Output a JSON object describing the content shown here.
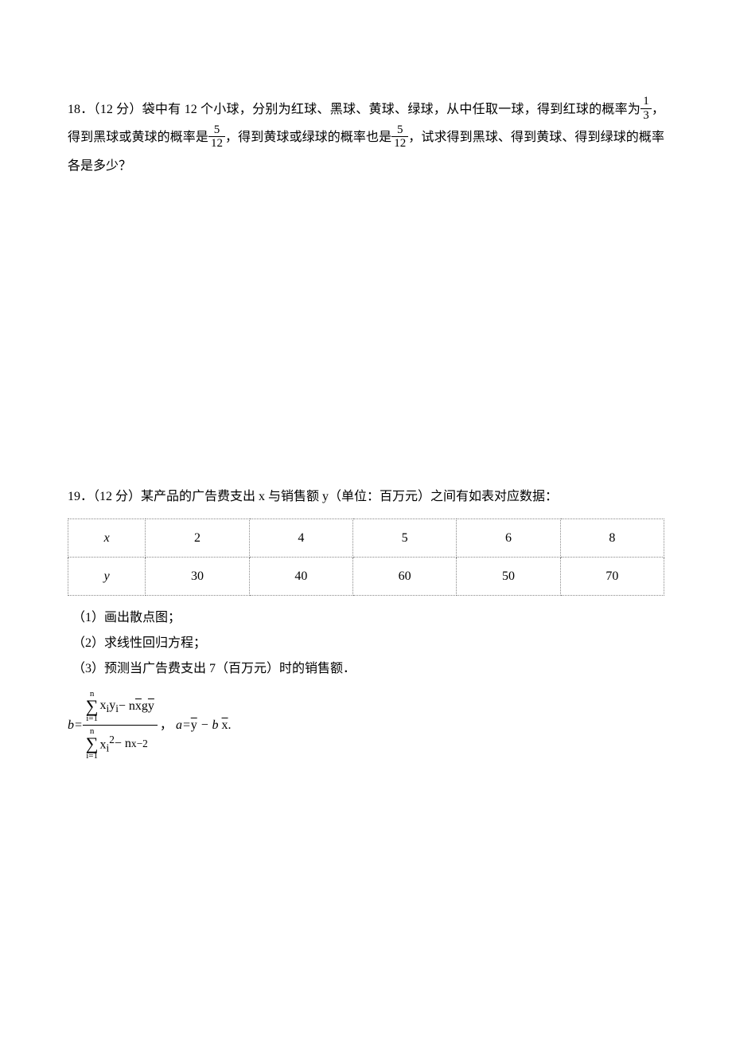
{
  "problem18": {
    "text_part1": "18．（12 分）袋中有 12 个小球，分别为红球、黑球、黄球、绿球，从中任取一球，得到红球的概率为",
    "frac1_num": "1",
    "frac1_den": "3",
    "text_part2": "，得到黑球或黄球的概率是",
    "frac2_num": "5",
    "frac2_den": "12",
    "text_part3": "，得到黄球或绿球的概率也是",
    "frac3_num": "5",
    "frac3_den": "12",
    "text_part4": "，试求得到黑球、得到黄球、得到绿球的概率各是多少？"
  },
  "problem19": {
    "intro": "19．（12 分）某产品的广告费支出 x 与销售额 y（单位：百万元）之间有如表对应数据：",
    "table": {
      "row1_head": "x",
      "row1": [
        "2",
        "4",
        "5",
        "6",
        "8"
      ],
      "row2_head": "y",
      "row2": [
        "30",
        "40",
        "60",
        "50",
        "70"
      ]
    },
    "sub1": "（1）画出散点图；",
    "sub2": "（2）求线性回归方程；",
    "sub3": "（3）预测当广告费支出 7（百万元）时的销售额．",
    "formula": {
      "b_label": "b=",
      "sigma_top": "n",
      "sigma_bot": "i=1",
      "num_expr_1": "x",
      "num_expr_sub1": "i",
      "num_expr_2": "y",
      "num_expr_sub2": "i",
      "num_minus": " − n",
      "num_xbar": "x",
      "num_g": "g",
      "num_ybar": "y",
      "den_expr_1": "x",
      "den_expr_sub1": "i",
      "den_sq": "2",
      "den_minus": " − n",
      "den_xsub": "x",
      "den_neg2": "−2",
      "comma": "，",
      "a_expr_1": "a=",
      "a_ybar": "y",
      "a_minus": " − b ",
      "a_xbar": "x",
      "period": "."
    }
  }
}
